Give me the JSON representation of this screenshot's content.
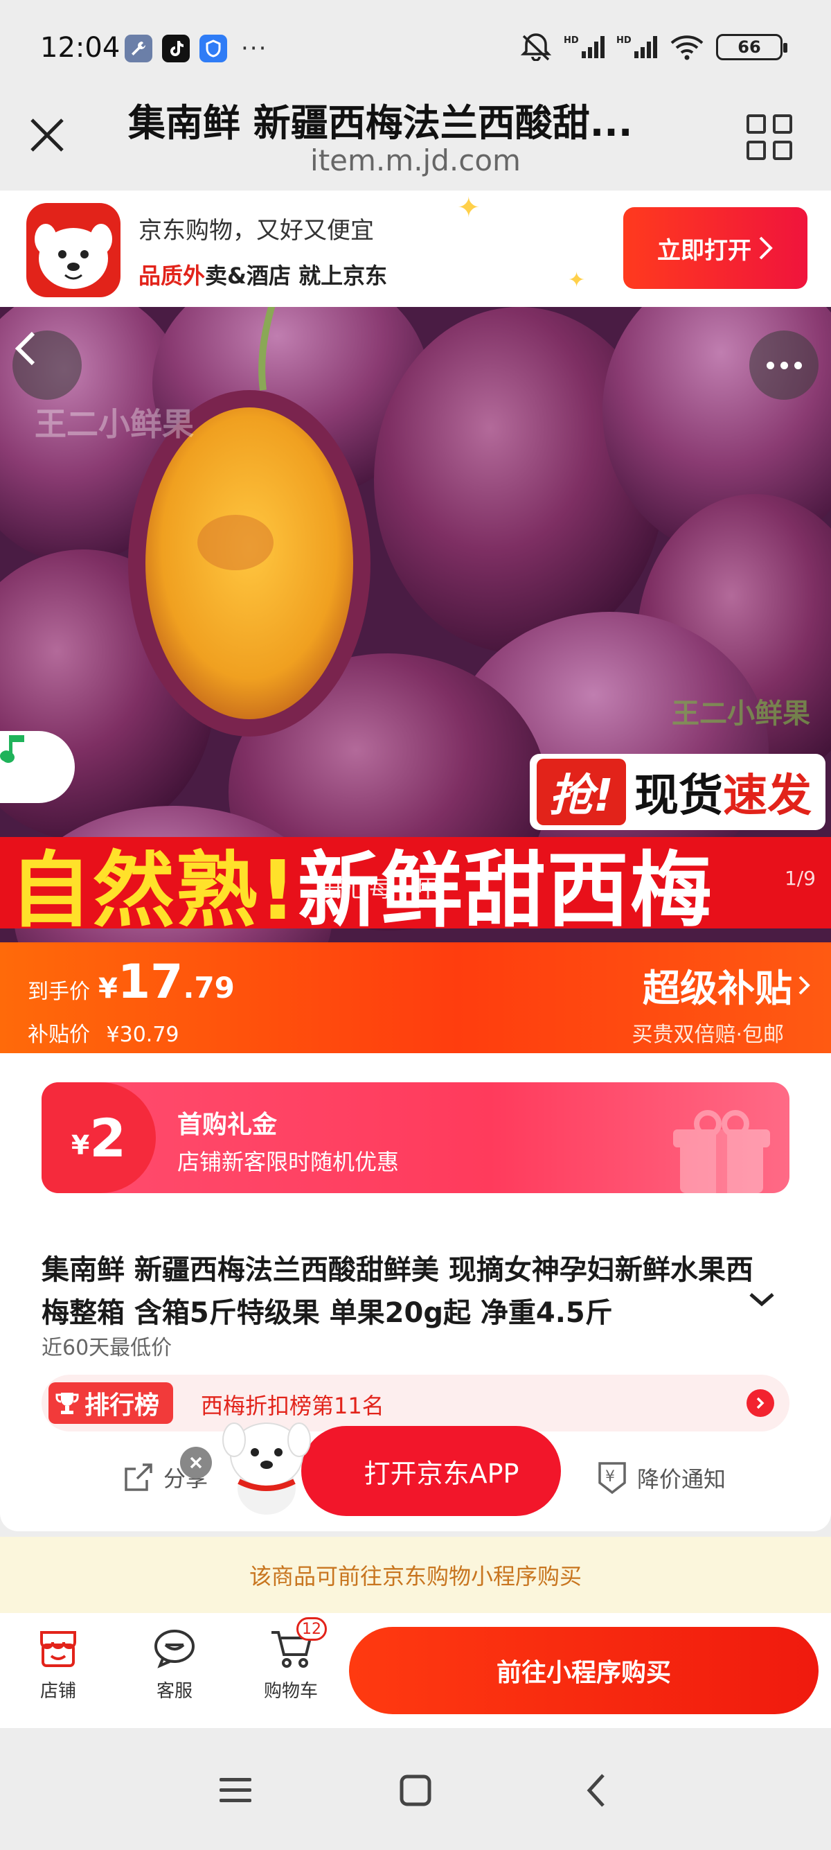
{
  "status_bar": {
    "time": "12:04",
    "dots": "···",
    "battery": "66"
  },
  "header": {
    "title": "集南鲜 新疆西梅法兰西酸甜...",
    "url": "item.m.jd.com"
  },
  "app_banner": {
    "line1": "京东购物，又好又便宜",
    "line2_red": "品质外",
    "line2_rest": "卖&酒店 就上京东",
    "open_button": "立即打开"
  },
  "hero": {
    "rush_badge_1": "抢!",
    "rush_badge_2": "现货",
    "rush_badge_3": "速发",
    "headline_yellow": "自然熟!",
    "headline_white": "新鲜甜西梅",
    "overlay_text": "开心每一甲",
    "page_indicator": "1/9",
    "watermark": "王二小鲜果"
  },
  "price": {
    "label": "到手价",
    "currency": "¥",
    "integer": "17",
    "decimal": ".79",
    "subsidy_label": "补贴价",
    "subsidy_value": "¥30.79",
    "super_subsidy": "超级补贴",
    "note": "买贵双倍赔·包邮"
  },
  "coupon": {
    "currency": "¥",
    "amount": "2",
    "title": "首购礼金",
    "subtitle": "店铺新客限时随机优惠"
  },
  "product": {
    "title": "集南鲜 新疆西梅法兰西酸甜鲜美 现摘女神孕妇新鲜水果西梅整箱 含箱5斤特级果 单果20g起 净重4.5斤",
    "low_price": "近60天最低价"
  },
  "ranking": {
    "tag": "排行榜",
    "text": "西梅折扣榜第11名"
  },
  "actions": {
    "share": "分享",
    "open_app": "打开京东APP",
    "price_alert": "降价通知"
  },
  "notice": "该商品可前往京东购物小程序购买",
  "bottom_bar": {
    "shop": "店铺",
    "service": "客服",
    "cart": "购物车",
    "cart_count": "12",
    "buy": "前往小程序购买"
  },
  "colors": {
    "brand_red": "#e2231a",
    "price_orange": "#ff4d0e",
    "coupon_pink": "#ff3b5c",
    "notice_bg": "#fbf6dc"
  }
}
